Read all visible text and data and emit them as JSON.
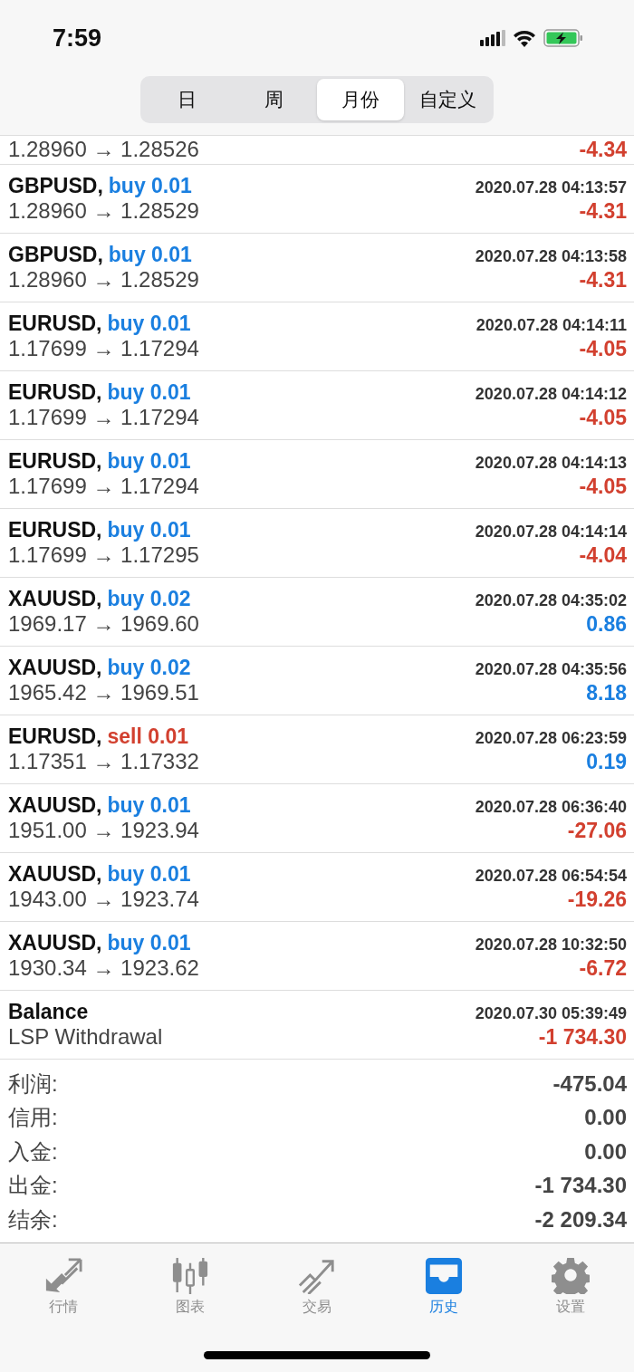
{
  "status_bar": {
    "time": "7:59"
  },
  "segments": [
    {
      "label": "日",
      "selected": false
    },
    {
      "label": "周",
      "selected": false
    },
    {
      "label": "月份",
      "selected": true
    },
    {
      "label": "自定义",
      "selected": false
    }
  ],
  "deals": [
    {
      "kind": "partial",
      "prices": "1.28960 → 1.28526",
      "profit": "-4.34",
      "loss": true
    },
    {
      "kind": "trade",
      "symbol": "GBPUSD,",
      "side": "buy",
      "volume": "0.01",
      "time": "2020.07.28 04:13:57",
      "prices": "1.28960 → 1.28529",
      "profit": "-4.31",
      "loss": true
    },
    {
      "kind": "trade",
      "symbol": "GBPUSD,",
      "side": "buy",
      "volume": "0.01",
      "time": "2020.07.28 04:13:58",
      "prices": "1.28960 → 1.28529",
      "profit": "-4.31",
      "loss": true
    },
    {
      "kind": "trade",
      "symbol": "EURUSD,",
      "side": "buy",
      "volume": "0.01",
      "time": "2020.07.28 04:14:11",
      "prices": "1.17699 → 1.17294",
      "profit": "-4.05",
      "loss": true
    },
    {
      "kind": "trade",
      "symbol": "EURUSD,",
      "side": "buy",
      "volume": "0.01",
      "time": "2020.07.28 04:14:12",
      "prices": "1.17699 → 1.17294",
      "profit": "-4.05",
      "loss": true
    },
    {
      "kind": "trade",
      "symbol": "EURUSD,",
      "side": "buy",
      "volume": "0.01",
      "time": "2020.07.28 04:14:13",
      "prices": "1.17699 → 1.17294",
      "profit": "-4.05",
      "loss": true
    },
    {
      "kind": "trade",
      "symbol": "EURUSD,",
      "side": "buy",
      "volume": "0.01",
      "time": "2020.07.28 04:14:14",
      "prices": "1.17699 → 1.17295",
      "profit": "-4.04",
      "loss": true
    },
    {
      "kind": "trade",
      "symbol": "XAUUSD,",
      "side": "buy",
      "volume": "0.02",
      "time": "2020.07.28 04:35:02",
      "prices": "1969.17 → 1969.60",
      "profit": "0.86",
      "loss": false
    },
    {
      "kind": "trade",
      "symbol": "XAUUSD,",
      "side": "buy",
      "volume": "0.02",
      "time": "2020.07.28 04:35:56",
      "prices": "1965.42 → 1969.51",
      "profit": "8.18",
      "loss": false
    },
    {
      "kind": "trade",
      "symbol": "EURUSD,",
      "side": "sell",
      "volume": "0.01",
      "time": "2020.07.28 06:23:59",
      "prices": "1.17351 → 1.17332",
      "profit": "0.19",
      "loss": false
    },
    {
      "kind": "trade",
      "symbol": "XAUUSD,",
      "side": "buy",
      "volume": "0.01",
      "time": "2020.07.28 06:36:40",
      "prices": "1951.00 → 1923.94",
      "profit": "-27.06",
      "loss": true
    },
    {
      "kind": "trade",
      "symbol": "XAUUSD,",
      "side": "buy",
      "volume": "0.01",
      "time": "2020.07.28 06:54:54",
      "prices": "1943.00 → 1923.74",
      "profit": "-19.26",
      "loss": true
    },
    {
      "kind": "trade",
      "symbol": "XAUUSD,",
      "side": "buy",
      "volume": "0.01",
      "time": "2020.07.28 10:32:50",
      "prices": "1930.34 → 1923.62",
      "profit": "-6.72",
      "loss": true
    },
    {
      "kind": "balance",
      "symbol": "Balance",
      "time": "2020.07.30 05:39:49",
      "prices": "LSP Withdrawal",
      "profit": "-1 734.30",
      "loss": true
    }
  ],
  "summary": [
    {
      "label": "利润:",
      "value": "-475.04"
    },
    {
      "label": "信用:",
      "value": "0.00"
    },
    {
      "label": "入金:",
      "value": "0.00"
    },
    {
      "label": "出金:",
      "value": "-1 734.30"
    },
    {
      "label": "结余:",
      "value": "-2 209.34"
    }
  ],
  "tab_bar": [
    {
      "label": "行情",
      "kind": "arrows",
      "selected": false
    },
    {
      "label": "图表",
      "kind": "candles",
      "selected": false
    },
    {
      "label": "交易",
      "kind": "trend",
      "selected": false
    },
    {
      "label": "历史",
      "kind": "tray",
      "selected": true
    },
    {
      "label": "设置",
      "kind": "gear",
      "selected": false
    }
  ]
}
